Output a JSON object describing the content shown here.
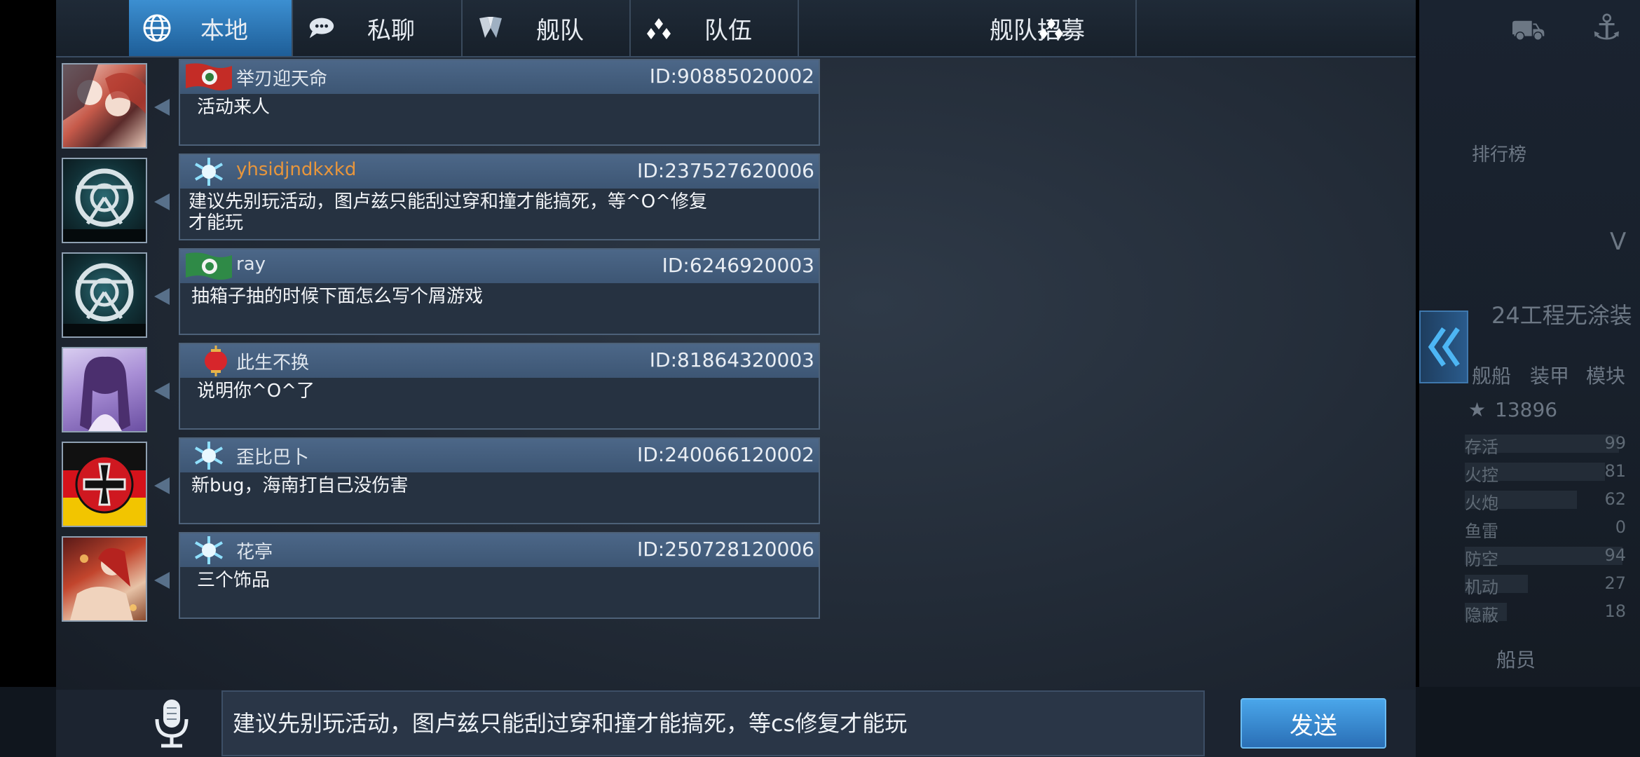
{
  "tabs": [
    {
      "label": "本地",
      "icon": "globe-icon",
      "active": true
    },
    {
      "label": "私聊",
      "icon": "speech-bubble-icon",
      "active": false
    },
    {
      "label": "舰队",
      "icon": "fleet-icon",
      "active": false
    },
    {
      "label": "队伍",
      "icon": "team-icon",
      "active": false
    },
    {
      "label": "舰队招募",
      "icon": "team-icon",
      "active": false
    }
  ],
  "messages": [
    {
      "name": "举刃迎天命",
      "id": "ID:90885020002",
      "text": "活动来人",
      "name_color": "#dfe6ee",
      "badge": "red-flag-badge"
    },
    {
      "name": "yhsidjndkxkd",
      "id": "ID:237527620006",
      "text": "建议先别玩活动，图卢兹只能刮过穿和撞才能搞死，等^O^修复\n才能玩",
      "name_color": "#e8963c",
      "badge": "snowflake-badge"
    },
    {
      "name": "ray",
      "id": "ID:6246920003",
      "text": "抽箱子抽的时候下面怎么写个屑游戏",
      "name_color": "#dfe6ee",
      "badge": "green-flag-badge"
    },
    {
      "name": "此生不换",
      "id": "ID:81864320003",
      "text": "说明你^O^了",
      "name_color": "#dfe6ee",
      "badge": "lantern-badge"
    },
    {
      "name": "歪比巴卜",
      "id": "ID:240066120002",
      "text": "新bug，海南打自己没伤害",
      "name_color": "#dfe6ee",
      "badge": "snowflake-badge"
    },
    {
      "name": "花亭",
      "id": "ID:250728120006",
      "text": "三个饰品",
      "name_color": "#dfe6ee",
      "badge": "snowflake-badge"
    }
  ],
  "input": {
    "value": "建议先别玩活动，图卢兹只能刮过穿和撞才能搞死，等cs修复才能玩"
  },
  "send_label": "发送",
  "side": {
    "rank_label": "排行榜",
    "ship_name": "24工程无涂装",
    "tabs": [
      "舰船",
      "装甲",
      "模块"
    ],
    "score": "13896",
    "stats": [
      {
        "label": "存活",
        "value": "99"
      },
      {
        "label": "火控",
        "value": "81"
      },
      {
        "label": "火炮",
        "value": "62"
      },
      {
        "label": "鱼雷",
        "value": "0"
      },
      {
        "label": "防空",
        "value": "94"
      },
      {
        "label": "机动",
        "value": "27"
      },
      {
        "label": "隐蔽",
        "value": "18"
      }
    ],
    "crew_label": "船员",
    "partial_label": "V"
  }
}
